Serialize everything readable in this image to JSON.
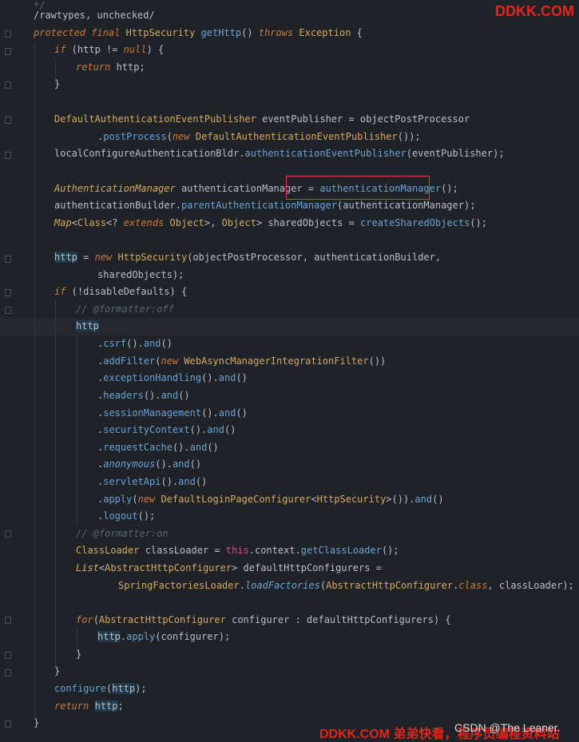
{
  "watermark_top": "DDKK.COM",
  "watermark_bottom": "DDKK.COM 弟弟快看，程序员编程资料站",
  "watermark_csdn": "CSDN @The Leaner.",
  "code": {
    "l1": "/rawtypes, unchecked/",
    "l2_kw1": "protected final",
    "l2_t": "HttpSecurity",
    "l2_fn": "getHttp",
    "l2_p": "()",
    "l2_kw2": "throws",
    "l2_t2": "Exception",
    "l2_b": " {",
    "l3_kw": "if",
    "l3_a": " (http != ",
    "l3_null": "null",
    "l3_b": ") {",
    "l4_kw": "return",
    "l4_a": " http;",
    "l5": "}",
    "l6_t": "DefaultAuthenticationEventPublisher",
    "l6_a": " eventPublisher = objectPostProcessor",
    "l7_a": ".",
    "l7_fn": "postProcess",
    "l7_b": "(",
    "l7_kw": "new",
    "l7_t": "DefaultAuthenticationEventPublisher",
    "l7_c": "());",
    "l8_a": "localConfigureAuthenticationBldr.",
    "l8_fn": "authenticationEventPublisher",
    "l8_b": "(eventPublisher);",
    "l9_t": "AuthenticationManager",
    "l9_a": " authenticationManager = ",
    "l9_fn": "authenticationManager",
    "l9_b": "();",
    "l10_a": "authenticationBuilder.",
    "l10_fn": "parentAuthenticationManager",
    "l10_b": "(authenticationManager);",
    "l11_t": "Map",
    "l11_a": "<",
    "l11_t2": "Class",
    "l11_b": "<? ",
    "l11_kw": "extends",
    "l11_t3": "Object",
    "l11_c": ">, ",
    "l11_t4": "Object",
    "l11_d": "> sharedObjects = ",
    "l11_fn": "createSharedObjects",
    "l11_e": "();",
    "l12_a": "http",
    "l12_b": " = ",
    "l12_kw": "new",
    "l12_t": "HttpSecurity",
    "l12_c": "(objectPostProcessor, authenticationBuilder,",
    "l13": "sharedObjects);",
    "l14_kw": "if",
    "l14_a": " (!disableDefaults) {",
    "l15": "// @formatter:off",
    "l16": "http",
    "l17_a": ".",
    "l17_fn": "csrf",
    "l17_b": "().",
    "l17_fn2": "and",
    "l17_c": "()",
    "l18_a": ".",
    "l18_fn": "addFilter",
    "l18_b": "(",
    "l18_kw": "new",
    "l18_t": "WebAsyncManagerIntegrationFilter",
    "l18_c": "())",
    "l19_fn": "exceptionHandling",
    "l20_fn": "headers",
    "l21_fn": "sessionManagement",
    "l22_fn": "securityContext",
    "l23_fn": "requestCache",
    "l24_fn": "anonymous",
    "l25_fn": "servletApi",
    "l26_fn": "apply",
    "l26_kw": "new",
    "l26_t": "DefaultLoginPageConfigurer",
    "l26_lt": "<",
    "l26_t2": "HttpSecurity",
    "l26_c": ">()).",
    "l27_fn": "logout",
    "l27_b": "();",
    "l28": "// @formatter:on",
    "l29_t": "ClassLoader",
    "l29_a": " classLoader = ",
    "l29_this": "this",
    "l29_b": ".context.",
    "l29_fn": "getClassLoader",
    "l29_c": "();",
    "l30_t": "List",
    "l30_a": "<",
    "l30_t2": "AbstractHttpConfigurer",
    "l30_b": "> defaultHttpConfigurers =",
    "l31_t": "SpringFactoriesLoader",
    "l31_a": ".",
    "l31_fn": "loadFactories",
    "l31_b": "(",
    "l31_t2": "AbstractHttpConfigurer",
    "l31_c": ".",
    "l31_kw": "class",
    "l31_d": ", classLoader);",
    "l32_kw": "for",
    "l32_a": "(",
    "l32_t": "AbstractHttpConfigurer",
    "l32_b": " configurer : defaultHttpConfigurers) {",
    "l33_a": "http",
    "l33_b": ".",
    "l33_fn": "apply",
    "l33_c": "(configurer);",
    "l34": "}",
    "l35": "}",
    "l36_fn": "configure",
    "l36_a": "(",
    "l36_b": "http",
    "l36_c": ");",
    "l37_kw": "return",
    "l37_a": "http",
    "l37_b": ";",
    "l38": "}",
    "dot": ".",
    "and_call": "().",
    "and": "and",
    "end_call": "()"
  }
}
